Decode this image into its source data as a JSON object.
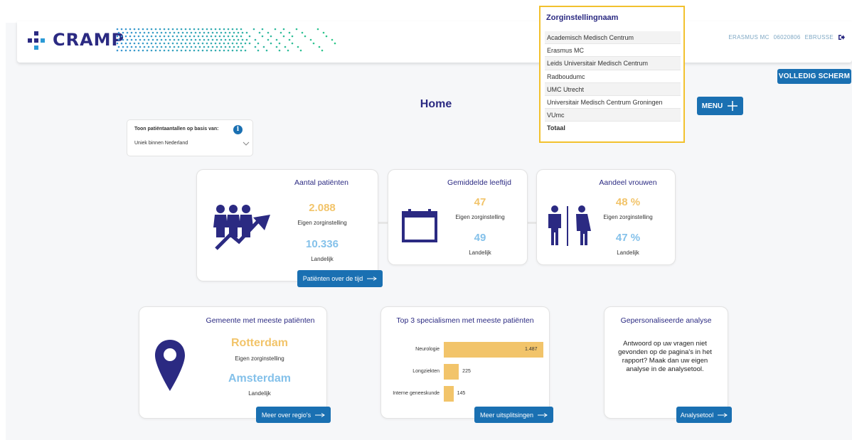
{
  "header": {
    "logo_text": "CRAMP",
    "user": [
      "ERASMUS MC",
      "06020806",
      "EBRUSSE"
    ]
  },
  "buttons": {
    "fullscreen": "VOLLEDIG SCHERM",
    "menu": "MENU"
  },
  "page_title": "Home",
  "dropdown": {
    "title": "Zorginstellingnaam",
    "items": [
      "Academisch Medisch Centrum",
      "Erasmus MC",
      "Leids Universitair Medisch Centrum",
      "Radboudumc",
      "UMC Utrecht",
      "Universitair Medisch Centrum Groningen",
      "VUmc",
      "Totaal"
    ]
  },
  "filter": {
    "label": "Toon patiëntaantallen op basis van:",
    "selected": "Uniek binnen Nederland"
  },
  "cards": {
    "patients": {
      "title": "Aantal patiënten",
      "own_value": "2.088",
      "own_label": "Eigen zorginstelling",
      "national_value": "10.336",
      "national_label": "Landelijk",
      "button": "Patiënten over de tijd"
    },
    "age": {
      "title": "Gemiddelde leeftijd",
      "own_value": "47",
      "own_label": "Eigen zorginstelling",
      "national_value": "49",
      "national_label": "Landelijk"
    },
    "women": {
      "title": "Aandeel vrouwen",
      "own_value": "48 %",
      "own_label": "Eigen zorginstelling",
      "national_value": "47 %",
      "national_label": "Landelijk"
    },
    "municipality": {
      "title": "Gemeente met meeste patiënten",
      "own_value": "Rotterdam",
      "own_label": "Eigen zorginstelling",
      "national_value": "Amsterdam",
      "national_label": "Landelijk",
      "button": "Meer over regio's"
    },
    "specialisms": {
      "title": "Top 3 specialismen met meeste patiënten",
      "button": "Meer uitsplitsingen"
    },
    "analysis": {
      "title": "Gepersonaliseerde analyse",
      "text": "Antwoord op uw vragen niet gevonden op de pagina's in het rapport? Maak dan uw eigen analyse in de analysetool.",
      "button": "Analysetool"
    }
  },
  "chart_data": {
    "type": "bar",
    "orientation": "horizontal",
    "categories": [
      "Neurologie",
      "Longziekten",
      "Interne geneeskunde"
    ],
    "values": [
      1487,
      225,
      145
    ],
    "value_labels": [
      "1.487",
      "225",
      "145"
    ],
    "title": "Top 3 specialismen met meeste patiënten",
    "grid": false
  },
  "colors": {
    "navy": "#2b2a82",
    "button_blue": "#1a70b2",
    "orange": "#f2c46a",
    "light_blue": "#84c1ea",
    "dropdown_border": "#f2c12e"
  },
  "icons": {
    "logout": "logout-icon",
    "plus": "plus-icon",
    "arrow": "arrow-right-icon",
    "chevron": "chevron-down-icon",
    "info": "info-icon",
    "people_growth": "people-growth-icon",
    "calendar": "calendar-icon",
    "gender": "gender-icon",
    "location": "location-pin-icon"
  }
}
